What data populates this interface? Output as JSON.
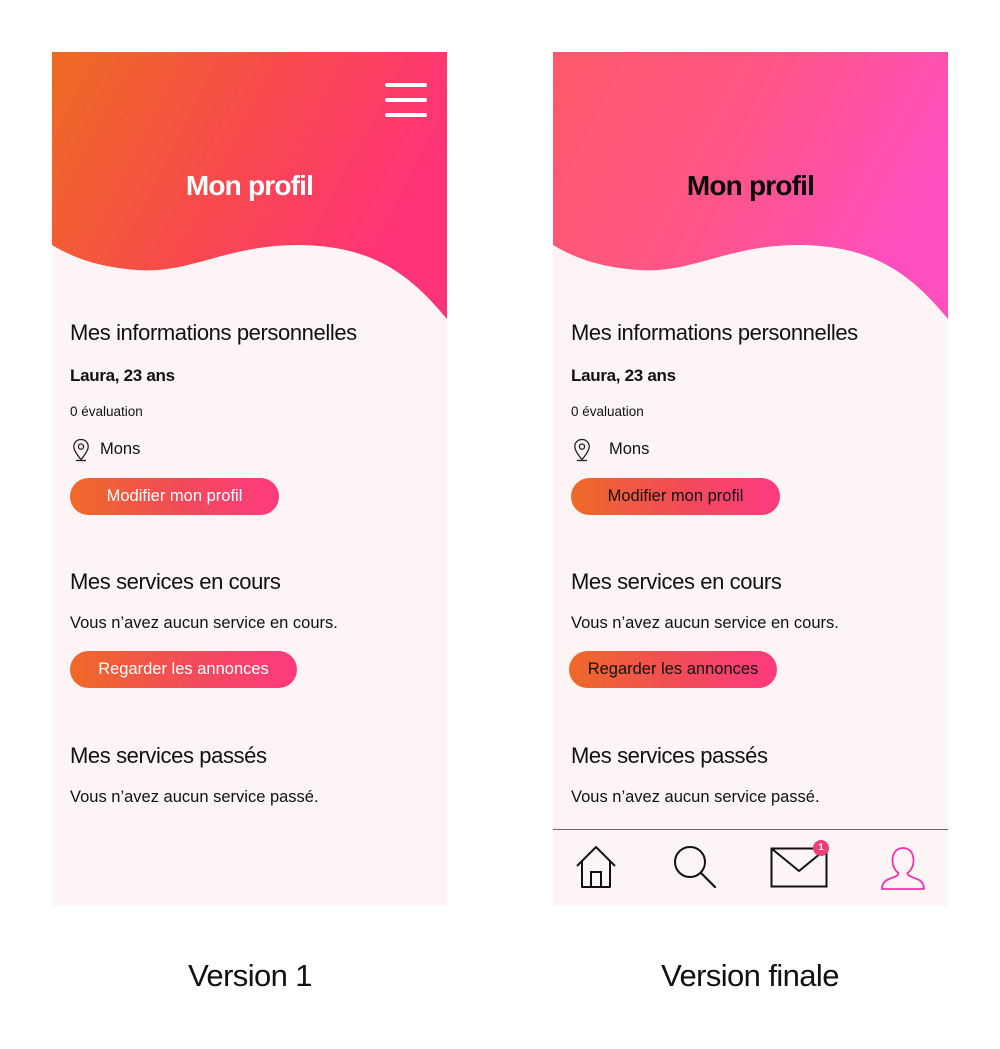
{
  "versions": [
    {
      "caption": "Version 1",
      "title": "Mon profil",
      "personal": {
        "heading": "Mes informations personnelles",
        "name": "Laura, 23 ans",
        "rating": "0 évaluation",
        "location": "Mons",
        "edit_button": "Modifier mon profil"
      },
      "current": {
        "heading": "Mes services en cours",
        "text": "Vous n’avez aucun service en cours.",
        "button": "Regarder les annonces"
      },
      "past": {
        "heading": "Mes services passés",
        "text": "Vous n’avez aucun service passé."
      },
      "icons": [
        "menu-icon",
        "location-pin-icon"
      ]
    },
    {
      "caption": "Version finale",
      "title": "Mon profil",
      "personal": {
        "heading": "Mes informations personnelles",
        "name": "Laura, 23 ans",
        "rating": "0 évaluation",
        "location": "Mons",
        "edit_button": "Modifier mon profil"
      },
      "current": {
        "heading": "Mes services en cours",
        "text": "Vous n’avez aucun service en cours.",
        "button": "Regarder les annonces"
      },
      "past": {
        "heading": "Mes services passés",
        "text": "Vous n’avez aucun service passé."
      },
      "bottom_nav": {
        "items": [
          "home-icon",
          "search-icon",
          "mail-icon",
          "profile-icon"
        ],
        "active": "profile-icon",
        "mail_badge": "1"
      }
    }
  ],
  "colors": {
    "v1_gradient": [
      "#ed6b22",
      "#ff3379"
    ],
    "v2_gradient": [
      "#fc5a6a",
      "#ff4fbe"
    ],
    "button_gradient": [
      "#ee6a28",
      "#ff3a80"
    ],
    "screen_bg": "#fcf4f5",
    "active_nav": "#f032b0",
    "badge": "#ef3d7a"
  }
}
